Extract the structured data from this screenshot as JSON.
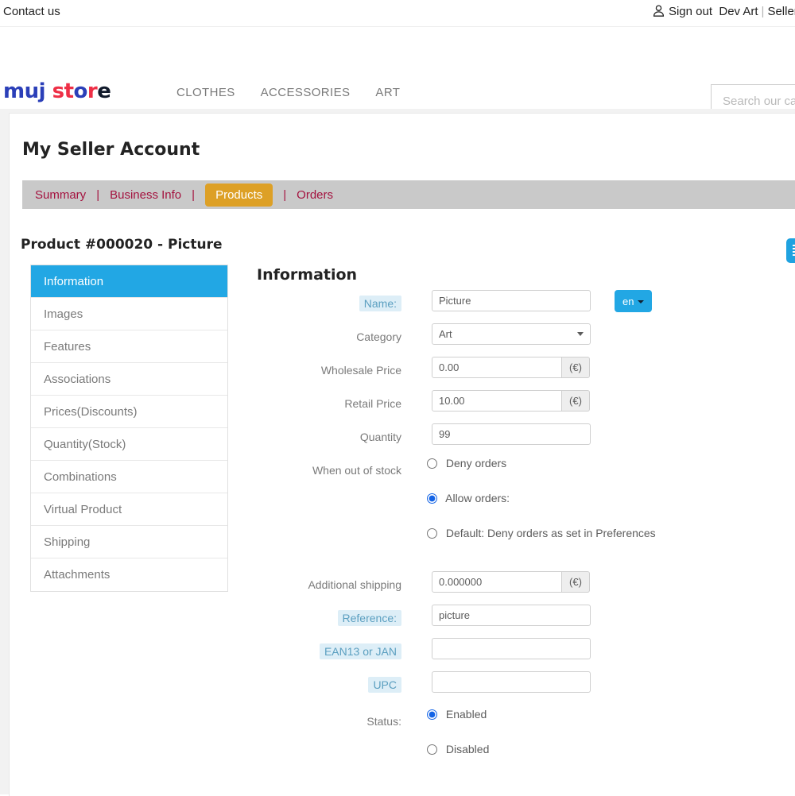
{
  "topbar": {
    "contact_label": "Contact us",
    "user_icon": "person-icon",
    "signout_label": "Sign out",
    "account_name": "Dev Art",
    "separator": "|",
    "seller_label": "Seller Sign"
  },
  "header": {
    "logo": [
      {
        "ch": "m",
        "color": "#2b3fb8"
      },
      {
        "ch": "y",
        "color": "#2b3fb8"
      },
      {
        "ch": " ",
        "color": "#000000"
      },
      {
        "ch": "s",
        "color": "#ee2f46"
      },
      {
        "ch": "t",
        "color": "#ee2f46"
      },
      {
        "ch": "o",
        "color": "#2b3fb8"
      },
      {
        "ch": "r",
        "color": "#ee2f46"
      },
      {
        "ch": "e",
        "color": "#0f1b2e"
      }
    ],
    "logo_text": "my store",
    "menu": [
      {
        "label": "Clothes"
      },
      {
        "label": "Accessories"
      },
      {
        "label": "Art"
      }
    ],
    "search_placeholder": "Search our catalog",
    "search_value": ""
  },
  "account": {
    "page_title": "My Seller Account",
    "tabs": [
      {
        "label": "Summary",
        "active": false
      },
      {
        "label": "Business Info",
        "active": false
      },
      {
        "label": "Products",
        "active": true
      },
      {
        "label": "Orders",
        "active": false
      }
    ],
    "tab_divider": "|",
    "product_title": "Product #000020 - Picture",
    "side_tab_icon": "grid-panel-icon"
  },
  "sidenav": {
    "items": [
      {
        "label": "Information",
        "active": true
      },
      {
        "label": "Images",
        "active": false
      },
      {
        "label": "Features",
        "active": false
      },
      {
        "label": "Associations",
        "active": false
      },
      {
        "label": "Prices(Discounts)",
        "active": false
      },
      {
        "label": "Quantity(Stock)",
        "active": false
      },
      {
        "label": "Combinations",
        "active": false
      },
      {
        "label": "Virtual Product",
        "active": false
      },
      {
        "label": "Shipping",
        "active": false
      },
      {
        "label": "Attachments",
        "active": false
      }
    ]
  },
  "form": {
    "title": "Information",
    "name_label": "Name:",
    "name_value": "Picture",
    "lang_button": "en",
    "category_label": "Category",
    "category_value": "Art",
    "category_options": [
      "Art"
    ],
    "wholesale_label": "Wholesale Price",
    "wholesale_value": "0.00",
    "wholesale_suffix": "(€)",
    "retail_label": "Retail Price",
    "retail_value": "10.00",
    "retail_suffix": "(€)",
    "quantity_label": "Quantity",
    "quantity_value": "99",
    "oos_label": "When out of stock",
    "oos_options": [
      {
        "label": "Deny orders",
        "checked": false
      },
      {
        "label": "Allow orders:",
        "checked": true
      },
      {
        "label": "Default: Deny orders as set in Preferences",
        "checked": false
      }
    ],
    "shipping_label": "Additional shipping",
    "shipping_value": "0.000000",
    "shipping_suffix": "(€)",
    "reference_label": "Reference:",
    "reference_value": "picture",
    "ean_label": "EAN13 or JAN",
    "ean_value": "",
    "upc_label": "UPC",
    "upc_value": "",
    "status_label": "Status:",
    "status_options": [
      {
        "label": "Enabled",
        "checked": true
      },
      {
        "label": "Disabled",
        "checked": false
      }
    ]
  },
  "colors": {
    "accent_blue": "#22a7e4",
    "tab_active_gold": "#dda026",
    "tab_link_crimson": "#a4123f",
    "tabstrip_bg": "#c9c9c9",
    "page_bg": "#f2f2f2",
    "label_highlight_bg": "#ddeef7",
    "label_highlight_fg": "#5b9fc0",
    "radio_checked": "#1464e6"
  }
}
